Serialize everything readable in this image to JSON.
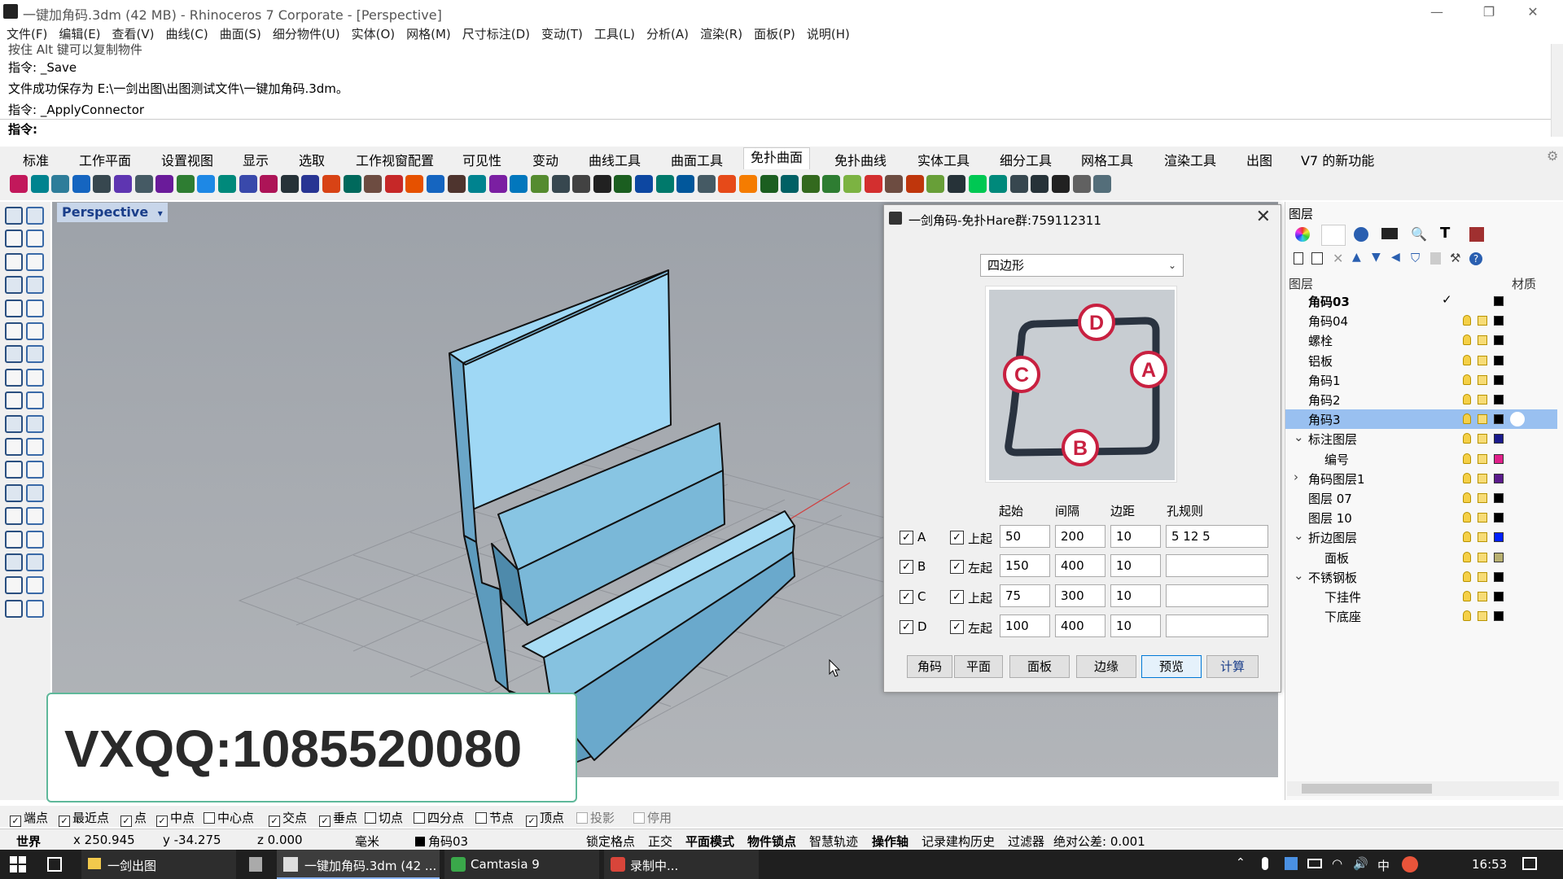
{
  "window": {
    "title": "一键加角码.3dm (42 MB) - Rhinoceros 7 Corporate - [Perspective]",
    "minimize": "—",
    "maximize": "❐",
    "close": "✕"
  },
  "menu": [
    "文件(F)",
    "编辑(E)",
    "查看(V)",
    "曲线(C)",
    "曲面(S)",
    "细分物件(U)",
    "实体(O)",
    "网格(M)",
    "尺寸标注(D)",
    "变动(T)",
    "工具(L)",
    "分析(A)",
    "渲染(R)",
    "面板(P)",
    "说明(H)"
  ],
  "command_history": [
    "按住 Alt 键可以复制物件",
    "指令: _Save",
    "文件成功保存为 E:\\一剑出图\\出图测试文件\\一键加角码.3dm。",
    "指令: _ApplyConnector"
  ],
  "command_prompt": "指令:",
  "toolbar_tabs": [
    "标准",
    "工作平面",
    "设置视图",
    "显示",
    "选取",
    "工作视窗配置",
    "可见性",
    "变动",
    "曲线工具",
    "曲面工具",
    "免扑曲面",
    "免扑曲线",
    "实体工具",
    "细分工具",
    "网格工具",
    "渲染工具",
    "出图",
    "V7 的新功能"
  ],
  "active_tab": "免扑曲面",
  "viewport": {
    "label": "Perspective",
    "menu_arrow": "▾"
  },
  "dialog": {
    "title": "一剑角码-免扑Hare群:759112311",
    "close": "✕",
    "shape": "四边形",
    "shape_arrow": "⌄",
    "preview_labels": [
      "D",
      "A",
      "B",
      "C"
    ],
    "headers": {
      "start": "起始",
      "gap": "间隔",
      "margin": "边距",
      "hole_rule": "孔规则"
    },
    "rows": [
      {
        "name": "A",
        "mode": "上起",
        "start": "50",
        "gap": "200",
        "margin": "10",
        "hole": "5 12 5",
        "checked": "✓"
      },
      {
        "name": "B",
        "mode": "左起",
        "start": "150",
        "gap": "400",
        "margin": "10",
        "hole": "",
        "checked": "✓"
      },
      {
        "name": "C",
        "mode": "上起",
        "start": "75",
        "gap": "300",
        "margin": "10",
        "hole": "",
        "checked": "✓"
      },
      {
        "name": "D",
        "mode": "左起",
        "start": "100",
        "gap": "400",
        "margin": "10",
        "hole": "",
        "checked": "✓"
      }
    ],
    "buttons": [
      "角码",
      "平面",
      "面板",
      "边缘",
      "预览",
      "计算"
    ]
  },
  "layers_panel": {
    "title": "图层",
    "col_layer": "图层",
    "col_material": "材质",
    "check": "✓",
    "layers": [
      {
        "name": "角码03",
        "bold": true,
        "indent": 0,
        "color": "#000000",
        "current": true
      },
      {
        "name": "角码04",
        "indent": 0,
        "color": "#000000"
      },
      {
        "name": "螺栓",
        "indent": 0,
        "color": "#000000"
      },
      {
        "name": "铝板",
        "indent": 0,
        "color": "#000000"
      },
      {
        "name": "角码1",
        "indent": 0,
        "color": "#000000"
      },
      {
        "name": "角码2",
        "indent": 0,
        "color": "#000000"
      },
      {
        "name": "角码3",
        "indent": 0,
        "color": "#000000",
        "selected": true
      },
      {
        "name": "标注图层",
        "indent": 0,
        "color": "#1a1a8c",
        "expand": "⌄"
      },
      {
        "name": "编号",
        "indent": 1,
        "color": "#e0208a"
      },
      {
        "name": "角码图层1",
        "indent": 0,
        "color": "#5a1a8c",
        "expand": "›"
      },
      {
        "name": "图层 07",
        "indent": 0,
        "color": "#000000"
      },
      {
        "name": "图层 10",
        "indent": 0,
        "color": "#000000"
      },
      {
        "name": "折边图层",
        "indent": 0,
        "color": "#0020ff",
        "expand": "⌄"
      },
      {
        "name": "面板",
        "indent": 1,
        "color": "#b8b070"
      },
      {
        "name": "不锈钢板",
        "indent": 0,
        "color": "#000000",
        "expand": "⌄"
      },
      {
        "name": "下挂件",
        "indent": 1,
        "color": "#000000"
      },
      {
        "name": "下底座",
        "indent": 1,
        "color": "#000000"
      }
    ]
  },
  "osnaps": [
    {
      "label": "端点",
      "on": true
    },
    {
      "label": "最近点",
      "on": true
    },
    {
      "label": "点",
      "on": true
    },
    {
      "label": "中点",
      "on": true
    },
    {
      "label": "中心点",
      "on": false
    },
    {
      "label": "交点",
      "on": true
    },
    {
      "label": "垂点",
      "on": true
    },
    {
      "label": "切点",
      "on": false
    },
    {
      "label": "四分点",
      "on": false
    },
    {
      "label": "节点",
      "on": false
    },
    {
      "label": "顶点",
      "on": true
    },
    {
      "label": "投影",
      "on": false
    },
    {
      "label": "停用",
      "on": false
    }
  ],
  "status": {
    "cplane": "世界",
    "x": "x 250.945",
    "y": "y -34.275",
    "z": "z 0.000",
    "units": "毫米",
    "layer": "角码03",
    "items": [
      "锁定格点",
      "正交",
      "平面模式",
      "物件锁点",
      "智慧轨迹",
      "操作轴",
      "记录建构历史",
      "过滤器",
      "绝对公差: 0.001"
    ]
  },
  "taskbar": {
    "apps": [
      "一剑出图",
      "一键加角码.3dm (42 ...",
      "Camtasia 9",
      "录制中..."
    ],
    "tray_lang": "中",
    "time": "16:53"
  },
  "overlay_text": "VXQQ:1085520080",
  "colors": {
    "accent": "#0078d7",
    "viewport_bg": "#a6aab0",
    "model_fill": "#a8d8f0",
    "layer_selected": "#99c0f0",
    "overlay_border": "#5fb89a"
  }
}
